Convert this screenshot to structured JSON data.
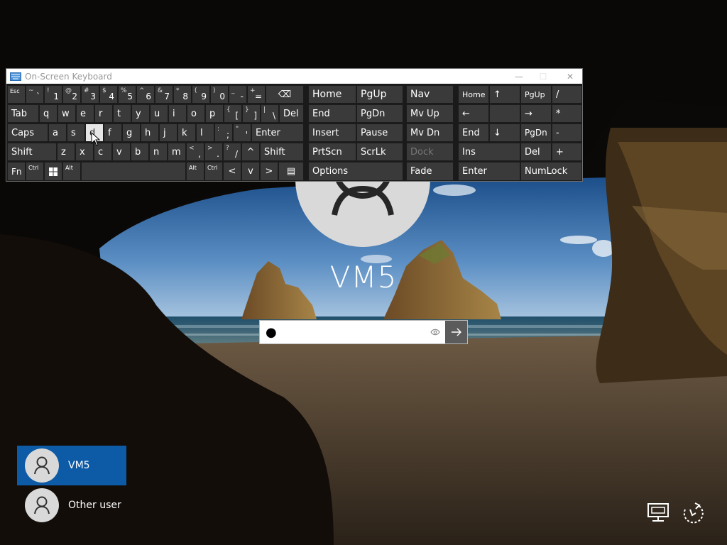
{
  "login": {
    "username": "VM5",
    "password_value": "●",
    "submit_glyph": "→",
    "reveal_glyph": "👁"
  },
  "users": [
    {
      "name": "VM5",
      "selected": true
    },
    {
      "name": "Other user",
      "selected": false
    }
  ],
  "osk": {
    "title": "On-Screen Keyboard",
    "controls": {
      "minimize": "—",
      "maximize": "☐",
      "close": "✕"
    },
    "rows": {
      "row1": [
        {
          "id": "esc",
          "main": "Esc"
        },
        {
          "id": "tilde",
          "shift": "~",
          "main": "`"
        },
        {
          "id": "1",
          "shift": "!",
          "main": "1"
        },
        {
          "id": "2",
          "shift": "@",
          "main": "2"
        },
        {
          "id": "3",
          "shift": "#",
          "main": "3"
        },
        {
          "id": "4",
          "shift": "$",
          "main": "4"
        },
        {
          "id": "5",
          "shift": "%",
          "main": "5"
        },
        {
          "id": "6",
          "shift": "^",
          "main": "6"
        },
        {
          "id": "7",
          "shift": "&",
          "main": "7"
        },
        {
          "id": "8",
          "shift": "*",
          "main": "8"
        },
        {
          "id": "9",
          "shift": "(",
          "main": "9"
        },
        {
          "id": "0",
          "shift": ")",
          "main": "0"
        },
        {
          "id": "minus",
          "shift": "_",
          "main": "-"
        },
        {
          "id": "equals",
          "shift": "+",
          "main": "="
        },
        {
          "id": "backspace",
          "main": "⌫"
        }
      ],
      "row2": [
        "Tab",
        "q",
        "w",
        "e",
        "r",
        "t",
        "y",
        "u",
        "i",
        "o",
        "p"
      ],
      "row2_brackets": [
        {
          "shift": "{",
          "main": "["
        },
        {
          "shift": "}",
          "main": "]"
        },
        {
          "shift": "|",
          "main": "\\"
        }
      ],
      "row2_del": "Del",
      "row3": [
        "Caps",
        "a",
        "s",
        "d",
        "f",
        "g",
        "h",
        "j",
        "k",
        "l"
      ],
      "row3_punct": [
        {
          "shift": ":",
          "main": ";"
        },
        {
          "shift": "\"",
          "main": "'"
        }
      ],
      "row3_enter": "Enter",
      "row4": [
        "Shift",
        "z",
        "x",
        "c",
        "v",
        "b",
        "n",
        "m"
      ],
      "row4_punct": [
        {
          "shift": "<",
          "main": ","
        },
        {
          "shift": ">",
          "main": "."
        },
        {
          "shift": "?",
          "main": "/"
        }
      ],
      "row4_up": "^",
      "row4_shift": "Shift",
      "row5": {
        "fn": "Fn",
        "ctrl": "Ctrl",
        "alt": "Alt",
        "alt2": "Alt",
        "ctrl2": "Ctrl",
        "left": "<",
        "down": "v",
        "right": ">",
        "menu": "▤"
      }
    },
    "nav_block": [
      [
        "Home",
        "PgUp",
        "Nav"
      ],
      [
        "End",
        "PgDn",
        "Mv Up"
      ],
      [
        "Insert",
        "Pause",
        "Mv Dn"
      ],
      [
        "PrtScn",
        "ScrLk",
        "Dock"
      ],
      [
        "Options",
        "Fade"
      ]
    ],
    "numpad": {
      "r1": [
        "Home",
        "↑",
        "PgUp",
        "/"
      ],
      "r2": [
        "←",
        "",
        "→",
        "*"
      ],
      "r3": [
        "End",
        "↓",
        "PgDn",
        "-"
      ],
      "r4": [
        "Ins",
        "Del",
        "+"
      ],
      "r5": [
        "Enter",
        "NumLock"
      ]
    },
    "pressed_key": "d"
  },
  "colors": {
    "accent": "#0d5aa7",
    "key_bg": "#3a3a3a",
    "pressed_bg": "#e6e6e6"
  }
}
